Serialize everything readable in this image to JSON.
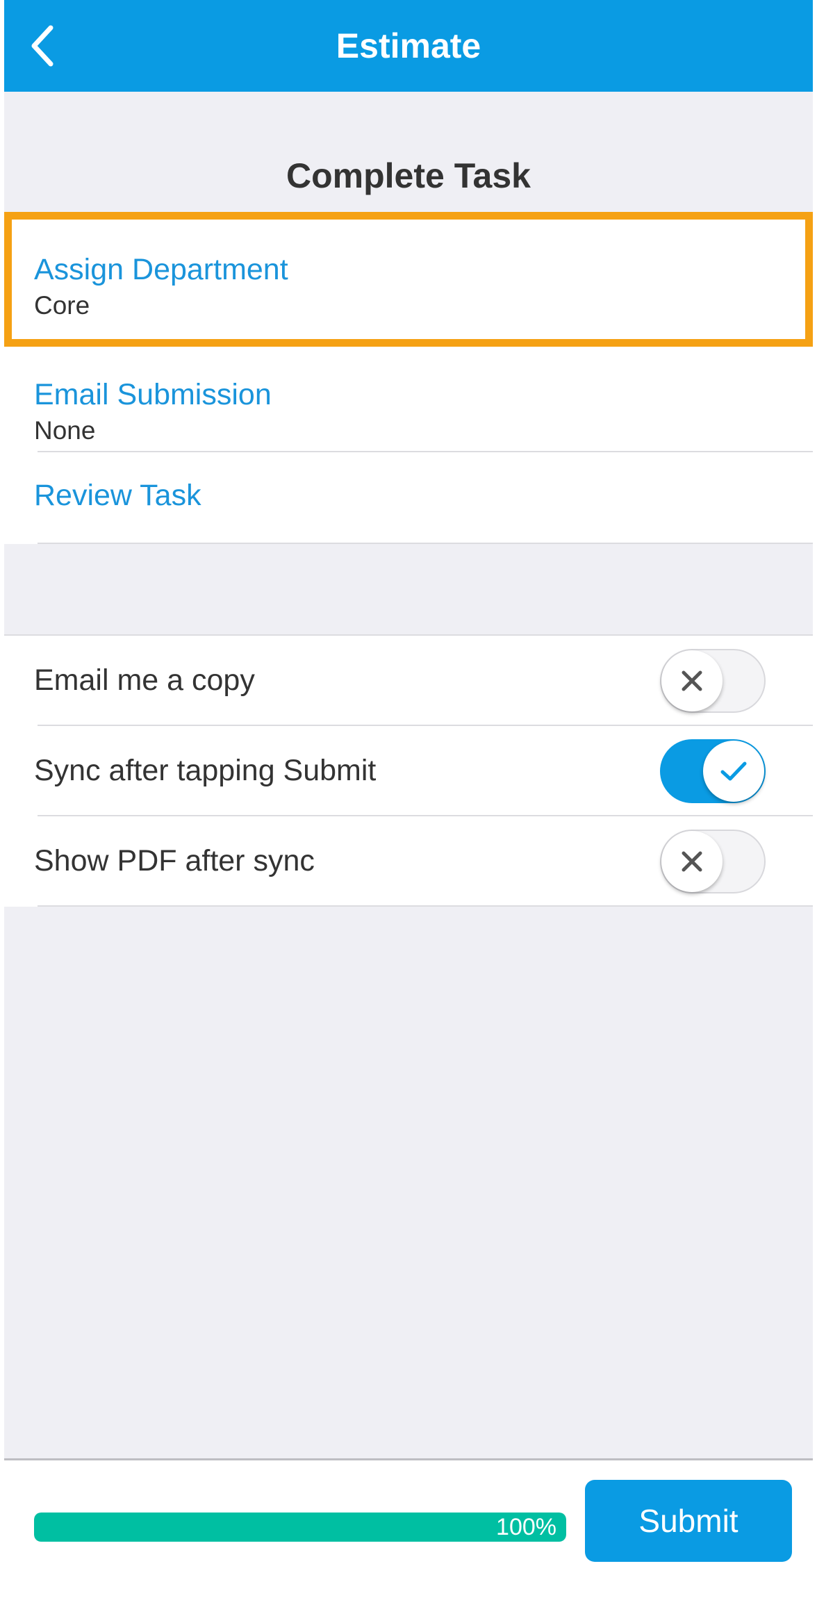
{
  "header": {
    "title": "Estimate",
    "back_icon": "chevron-left-icon"
  },
  "section": {
    "title": "Complete Task"
  },
  "fields": [
    {
      "label": "Assign Department",
      "value": "Core",
      "highlighted": true,
      "highlight_color": "#F5A114"
    },
    {
      "label": "Email Submission",
      "value": "None"
    },
    {
      "label": "Review Task"
    }
  ],
  "toggles": [
    {
      "label": "Email me a copy",
      "on": false
    },
    {
      "label": "Sync after tapping Submit",
      "on": true
    },
    {
      "label": "Show PDF after sync",
      "on": false
    }
  ],
  "footer": {
    "progress_percent": 100,
    "progress_text": "100%",
    "submit_label": "Submit"
  },
  "colors": {
    "header_bg": "#0A9BE3",
    "link_text": "#1A94DB",
    "toggle_on": "#0A9BE3",
    "progress_fill": "#00BFA2",
    "highlight": "#F5A114"
  }
}
